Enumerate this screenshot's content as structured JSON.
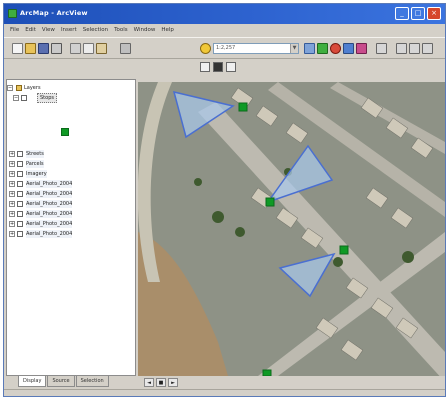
{
  "window": {
    "title": "ArcMap - ArcView",
    "min_label": "_",
    "max_label": "□",
    "close_label": "×"
  },
  "menu": {
    "items": [
      "File",
      "Edit",
      "View",
      "Insert",
      "Selection",
      "Tools",
      "Window",
      "Help"
    ]
  },
  "toolbar": {
    "scale_combo": "1:2,257",
    "icons": [
      "new-icon",
      "open-icon",
      "save-icon",
      "print-icon",
      "cut-icon",
      "copy-icon",
      "paste-icon",
      "undo-icon",
      "add-data-icon",
      "zoom-in-icon",
      "zoom-out-icon",
      "pan-icon",
      "identify-icon",
      "select-icon",
      "measure-icon"
    ]
  },
  "toc": {
    "root_label": "Layers",
    "layer_label": "Stops",
    "items": [
      "Streets",
      "Parcels",
      "Imagery",
      "Aerial_Photo_2004",
      "Aerial_Photo_2004",
      "Aerial_Photo_2004",
      "Aerial_Photo_2004",
      "Aerial_Photo_2004",
      "Aerial_Photo_2004"
    ],
    "colors": {
      "symbol": "#0f9a25",
      "view_cone_fill": "#a9c7ea",
      "view_cone_stroke": "#4a6fd1"
    }
  },
  "tabs": [
    "Display",
    "Source",
    "Selection"
  ],
  "map_ctrl": [
    "◄",
    "■",
    "►"
  ],
  "status": {
    "left": "",
    "middle": "",
    "right": ""
  }
}
